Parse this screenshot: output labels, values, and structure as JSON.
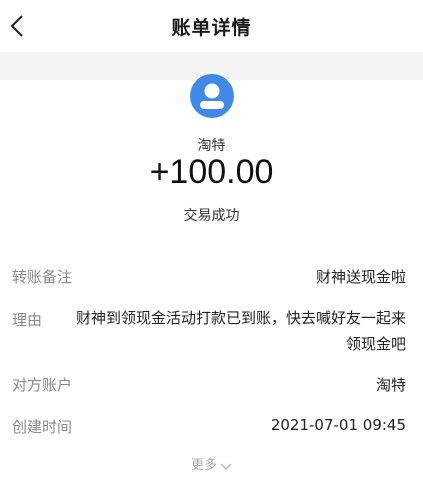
{
  "header": {
    "title": "账单详情"
  },
  "payee": {
    "name": "淘特",
    "amount": "+100.00",
    "status": "交易成功",
    "avatar_color": "#3f8ae8"
  },
  "details": {
    "remark": {
      "label": "转账备注",
      "value": "财神送现金啦"
    },
    "reason": {
      "label": "理由",
      "value": "财神到领现金活动打款已到账，快去喊好友一起来领现金吧"
    },
    "counterparty": {
      "label": "对方账户",
      "value": "淘特"
    },
    "created_time": {
      "label": "创建时间",
      "value": "2021-07-01 09:45"
    }
  },
  "more": {
    "label": "更多"
  }
}
